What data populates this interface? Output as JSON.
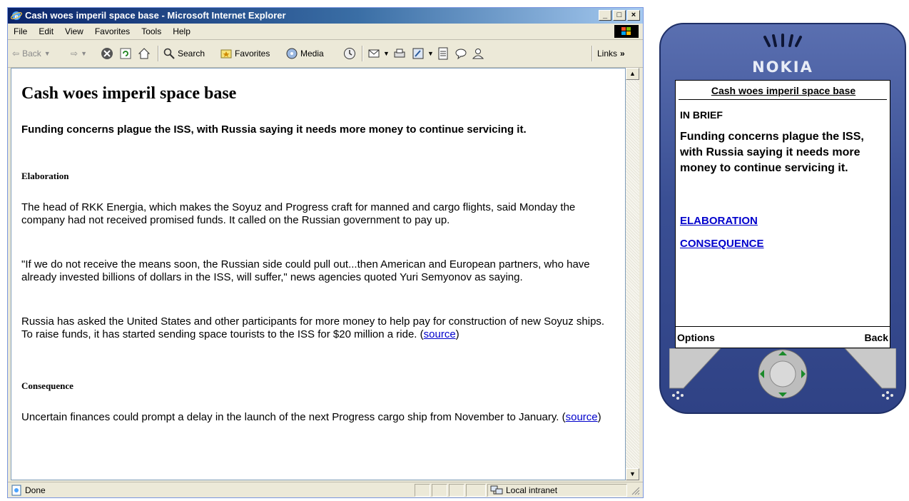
{
  "browser": {
    "title": "Cash woes imperil space base - Microsoft Internet Explorer",
    "menu": [
      "File",
      "Edit",
      "View",
      "Favorites",
      "Tools",
      "Help"
    ],
    "toolbar": {
      "back": "Back",
      "search": "Search",
      "favorites": "Favorites",
      "media": "Media",
      "links": "Links"
    },
    "status": {
      "done": "Done",
      "zone": "Local intranet"
    }
  },
  "article": {
    "title": "Cash woes imperil space base",
    "lead": "Funding concerns plague the ISS, with Russia saying it needs more money to continue servicing it.",
    "elaboration_heading": "Elaboration",
    "p1": "The head of RKK Energia, which makes the Soyuz and Progress craft for manned and cargo flights, said Monday the company had not received promised funds. It called on the Russian government to pay up.",
    "p2": "\"If we do not receive the means soon, the Russian side could pull out...then American and European partners, who have already invested billions of dollars in the ISS, will suffer,\" news agencies quoted Yuri Semyonov as saying.",
    "p3": "Russia has asked the United States and other participants for more money to help pay for construction of new Soyuz ships. To raise funds, it has started sending space tourists to the ISS for $20 million a ride.",
    "source_link": "source",
    "consequence_heading": "Consequence",
    "p4": "Uncertain finances could prompt a delay in the launch of the next Progress cargo ship from November to January."
  },
  "phone": {
    "brand": "NOKIA",
    "screen_title": "Cash woes imperil space base",
    "brief_label": "IN BRIEF",
    "summary": "Funding concerns plague the ISS, with Russia saying it needs more money to continue servicing it.",
    "links": [
      "ELABORATION",
      "CONSEQUENCE"
    ],
    "softkey_left": "Options",
    "softkey_right": "Back"
  },
  "colors": {
    "link": "#0000cc",
    "titlebar": "#0a246a",
    "phone_body": "#3a4f94"
  }
}
